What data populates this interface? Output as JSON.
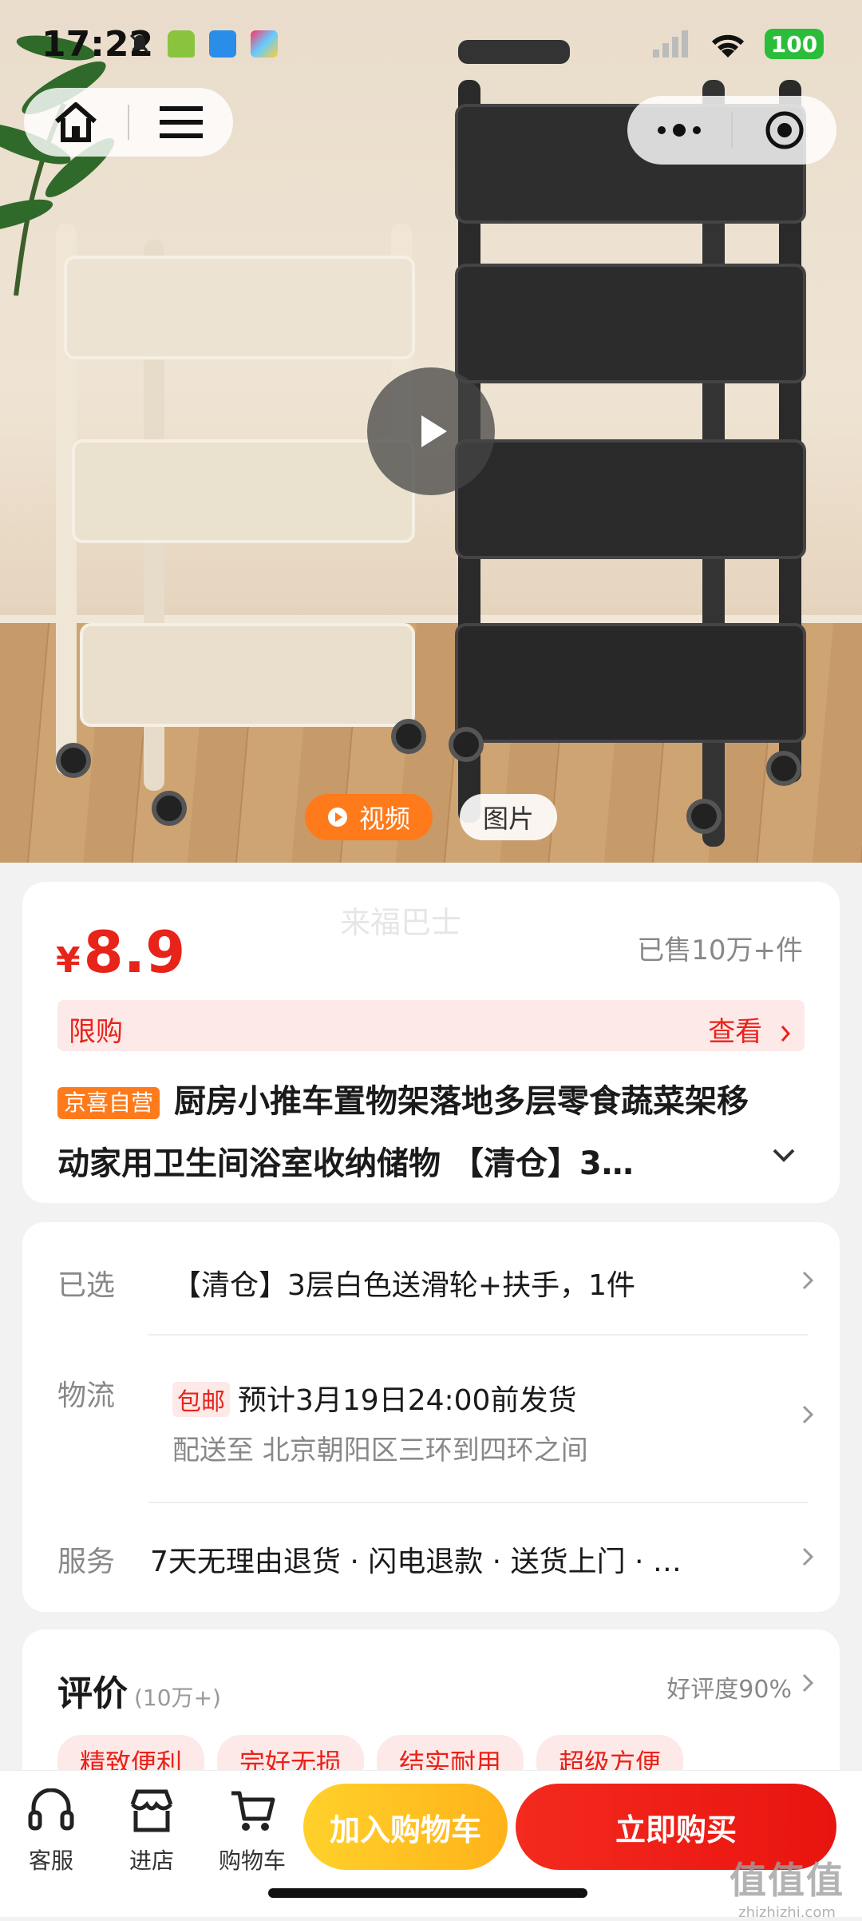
{
  "status_bar": {
    "time": "17:22",
    "battery": "100"
  },
  "media": {
    "tab_video": "视频",
    "tab_photo": "图片"
  },
  "product": {
    "currency": "¥",
    "price": "8.9",
    "sold": "已售10万+件",
    "watermark": "来福巴士",
    "limit_label": "限购",
    "limit_action": "查看",
    "badge": "京喜自营",
    "title": "厨房小推车置物架落地多层零食蔬菜架移动家用卫生间浴室收纳储物 【清仓】3…"
  },
  "details": {
    "selected_label": "已选",
    "selected_value": "【清仓】3层白色送滑轮+扶手，1件",
    "logistics_label": "物流",
    "free_ship_badge": "包邮",
    "ship_time": "预计3月19日24:00前发货",
    "deliver_to": "配送至 北京朝阳区三环到四环之间",
    "service_label": "服务",
    "service_value": "7天无理由退货 · 闪电退款 · 送货上门 · …"
  },
  "reviews": {
    "title": "评价",
    "count": "(10万+)",
    "rating": "好评度90%",
    "tags": [
      "精致便利",
      "完好无损",
      "结实耐用",
      "超级方便"
    ]
  },
  "bottom_bar": {
    "service": "客服",
    "store": "进店",
    "cart": "购物车",
    "add_cart": "加入购物车",
    "buy_now": "立即购买"
  },
  "corner_watermark": {
    "big": "值值值",
    "small": "zhizhizhi.com"
  },
  "colors": {
    "accent_red": "#e8231a",
    "orange": "#ff7a1a",
    "yellow": "#ffc21a"
  }
}
